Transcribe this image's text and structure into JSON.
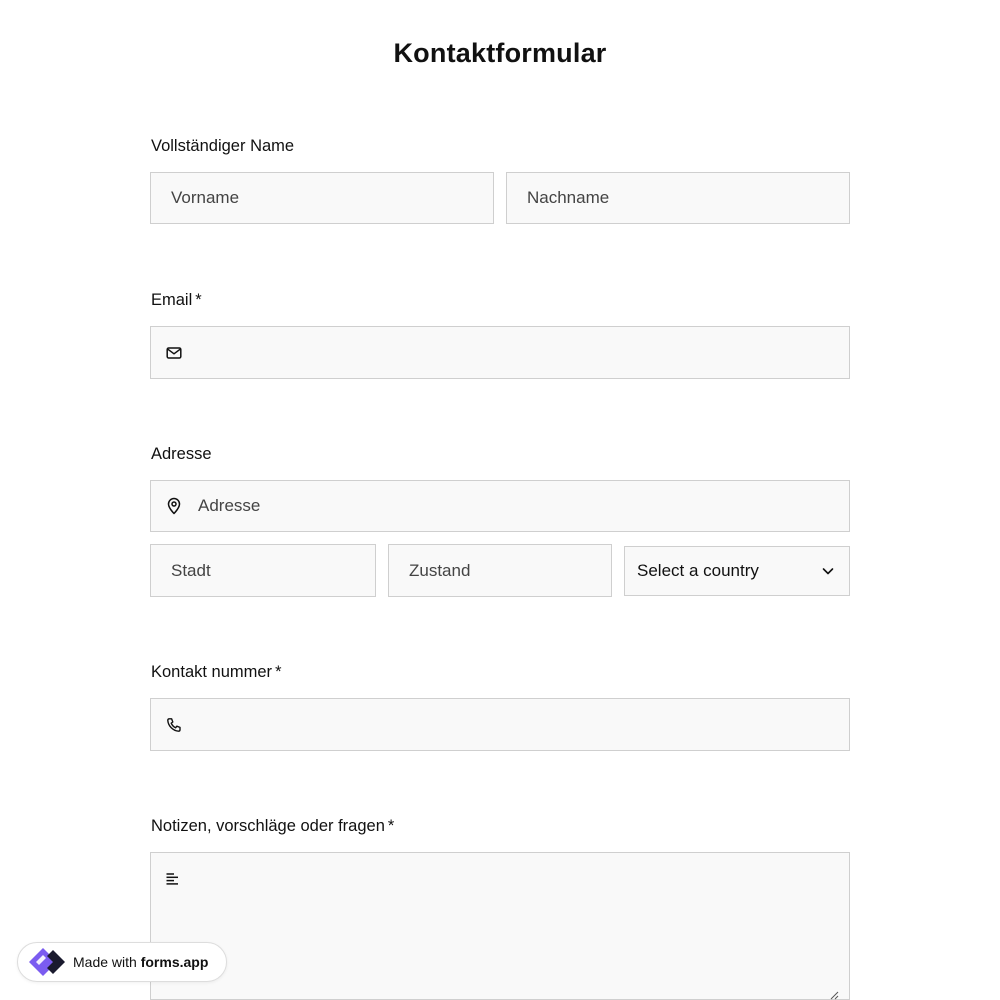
{
  "form": {
    "title": "Kontaktformular"
  },
  "full_name": {
    "label": "Vollständiger Name",
    "first_placeholder": "Vorname",
    "last_placeholder": "Nachname",
    "first_value": "",
    "last_value": ""
  },
  "email": {
    "label": "Email",
    "required_mark": "*",
    "placeholder": "",
    "value": "",
    "icon": "mail-icon"
  },
  "address": {
    "label": "Adresse",
    "street_placeholder": "Adresse",
    "city_placeholder": "Stadt",
    "state_placeholder": "Zustand",
    "country_selected": "Select a country",
    "street_icon": "map-pin-icon",
    "country_icon": "chevron-down-icon"
  },
  "phone": {
    "label": "Kontakt nummer",
    "required_mark": "*",
    "placeholder": "",
    "value": "",
    "icon": "phone-icon"
  },
  "notes": {
    "label": "Notizen, vorschläge oder fragen",
    "required_mark": "*",
    "value": "",
    "icon": "text-lines-icon"
  },
  "badge": {
    "prefix": "Made with ",
    "brand": "forms.app",
    "logo_colors": [
      "#7b5cf0",
      "#1a1a2e"
    ]
  },
  "colors": {
    "field_bg": "#f9f9f9",
    "field_border": "#cfcfcf",
    "text": "#111111"
  }
}
